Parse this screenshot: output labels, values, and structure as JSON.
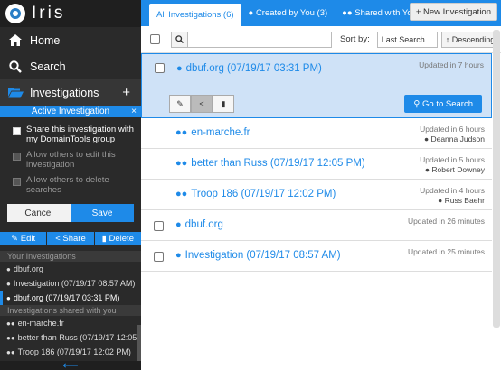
{
  "brand": {
    "name": "Iris"
  },
  "nav": {
    "home": "Home",
    "search": "Search",
    "investigations": "Investigations",
    "plus": "+"
  },
  "active_investigation": {
    "header": "Active Investigation",
    "close": "×",
    "options": [
      {
        "label": "Share this investigation with my DomainTools group",
        "checked": false,
        "enabled": true
      },
      {
        "label": "Allow others to edit this investigation",
        "checked": false,
        "enabled": false
      },
      {
        "label": "Allow others to delete searches",
        "checked": false,
        "enabled": false
      }
    ],
    "cancel": "Cancel",
    "save": "Save",
    "edit": "Edit",
    "share": "Share",
    "delete": "Delete"
  },
  "your_investigations": {
    "header": "Your Investigations",
    "items": [
      "dbuf.org",
      "Investigation (07/19/17 08:57 AM)",
      "dbuf.org (07/19/17 03:31 PM)"
    ]
  },
  "shared_investigations": {
    "header": "Investigations shared with you",
    "items": [
      "en-marche.fr",
      "better than Russ (07/19/17 12:05...",
      "Troop 186 (07/19/17 12:02 PM)"
    ]
  },
  "tabs": [
    {
      "label": "All Investigations (6)"
    },
    {
      "label": "Created by You (3)"
    },
    {
      "label": "Shared with You"
    }
  ],
  "new_investigation": "New Investigation",
  "toolbar": {
    "search_placeholder": "",
    "sort_by": "Sort by:",
    "sort_value": "Last Search",
    "sort_direction": "Descending"
  },
  "rows": [
    {
      "title": "dbuf.org (07/19/17 03:31 PM)",
      "updated": "Updated in 7 hours",
      "owner": "",
      "shared": false
    },
    {
      "title": "en-marche.fr",
      "updated": "Updated in 6 hours",
      "owner": "Deanna Judson",
      "shared": true
    },
    {
      "title": "better than Russ (07/19/17 12:05 PM)",
      "updated": "Updated in 5 hours",
      "owner": "Robert Downey",
      "shared": true
    },
    {
      "title": "Troop 186 (07/19/17 12:02 PM)",
      "updated": "Updated in 4 hours",
      "owner": "Russ Baehr",
      "shared": true
    },
    {
      "title": "dbuf.org",
      "updated": "Updated in 26 minutes",
      "owner": "",
      "shared": false
    },
    {
      "title": "Investigation (07/19/17 08:57 AM)",
      "updated": "Updated in 25 minutes",
      "owner": "",
      "shared": false
    }
  ],
  "go_to_search": "Go to Search",
  "colors": {
    "accent": "#1e8ae8",
    "sidebar": "#2a2a2a",
    "selected_row": "#cfe2f7"
  },
  "icons": {
    "brand": "iris-logo-icon",
    "home": "home-icon",
    "search": "search-icon",
    "investigations": "folder-open-icon",
    "user": "user-icon",
    "users": "users-icon",
    "back": "arrow-left-icon"
  }
}
